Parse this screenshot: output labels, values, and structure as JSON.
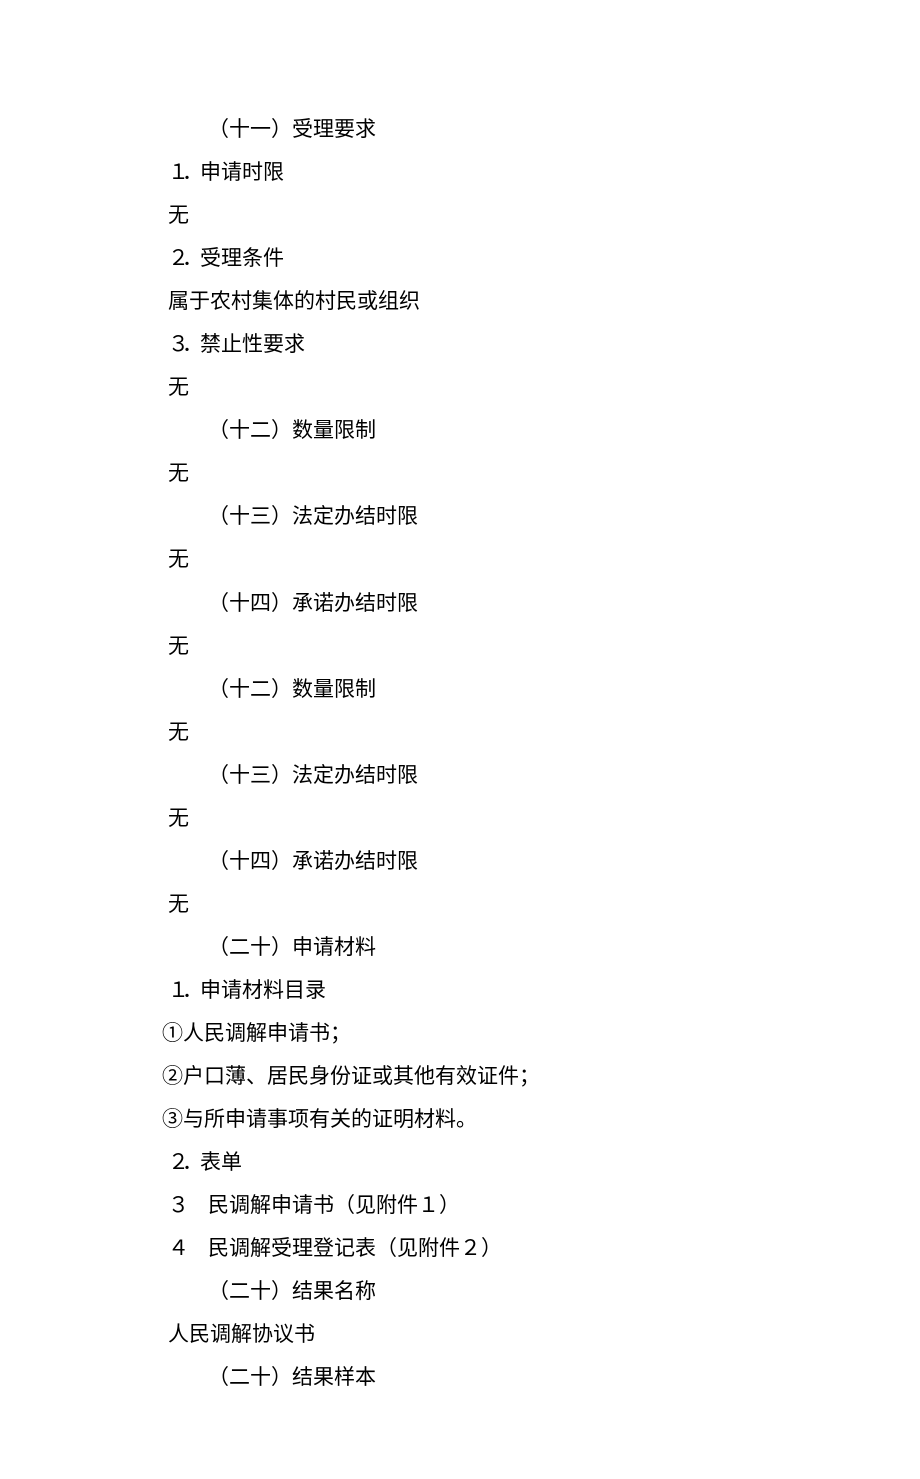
{
  "lines": [
    {
      "cls": "indent-1",
      "text": "（十一）受理要求"
    },
    {
      "cls": "indent-0 num-line",
      "segments": [
        "１",
        "．",
        "申请时限"
      ]
    },
    {
      "cls": "indent-0",
      "text": "无"
    },
    {
      "cls": "indent-0 num-line",
      "segments": [
        "２",
        "．",
        "受理条件"
      ]
    },
    {
      "cls": "indent-0",
      "text": "属于农村集体的村民或组织"
    },
    {
      "cls": "indent-0 num-line",
      "segments": [
        "３",
        "．",
        "禁止性要求"
      ]
    },
    {
      "cls": "indent-0",
      "text": "无"
    },
    {
      "cls": "indent-1",
      "text": "（十二）数量限制"
    },
    {
      "cls": "indent-0",
      "text": "无"
    },
    {
      "cls": "indent-1",
      "text": "（十三）法定办结时限"
    },
    {
      "cls": "indent-0",
      "text": "无"
    },
    {
      "cls": "indent-1",
      "text": "（十四）承诺办结时限"
    },
    {
      "cls": "indent-0",
      "text": "无"
    },
    {
      "cls": "indent-1",
      "text": "（十二）数量限制"
    },
    {
      "cls": "indent-0",
      "text": "无"
    },
    {
      "cls": "indent-1",
      "text": "（十三）法定办结时限"
    },
    {
      "cls": "indent-0",
      "text": "无"
    },
    {
      "cls": "indent-1",
      "text": "（十四）承诺办结时限"
    },
    {
      "cls": "indent-0",
      "text": "无"
    },
    {
      "cls": "indent-1",
      "text": "（二十）申请材料"
    },
    {
      "cls": "indent-0 num-line",
      "segments": [
        "１",
        "．",
        "申请材料目录"
      ]
    },
    {
      "cls": "circled",
      "text": "①人民调解申请书；"
    },
    {
      "cls": "circled",
      "text": "②户口薄、居民身份证或其他有效证件；"
    },
    {
      "cls": "circled",
      "text": "③与所申请事项有关的证明材料。"
    },
    {
      "cls": "indent-0 num-line",
      "segments": [
        "２",
        "．",
        "表单"
      ]
    },
    {
      "cls": "indent-0 num-line",
      "wide": true,
      "segments": [
        "３",
        "",
        "民调解申请书（见附件１）"
      ]
    },
    {
      "cls": "indent-0 num-line",
      "wide": true,
      "segments": [
        "４",
        "",
        "民调解受理登记表（见附件２）"
      ]
    },
    {
      "cls": "indent-1",
      "text": "（二十）结果名称"
    },
    {
      "cls": "indent-0",
      "text": "人民调解协议书"
    },
    {
      "cls": "indent-1",
      "text": "（二十）结果样本"
    }
  ]
}
